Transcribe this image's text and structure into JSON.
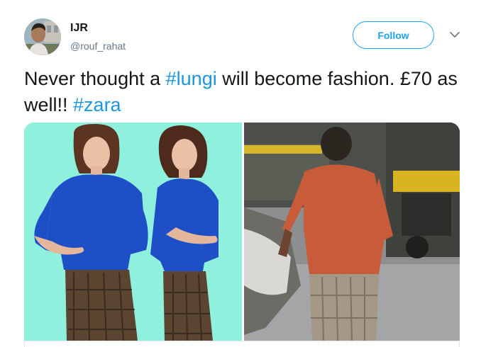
{
  "author": {
    "display_name": "IJR",
    "handle": "@rouf_rahat"
  },
  "actions": {
    "follow_label": "Follow",
    "more_icon": "chevron-down-icon"
  },
  "tweet": {
    "segments": [
      {
        "text": "Never thought a ",
        "type": "text"
      },
      {
        "text": "#lungi",
        "type": "hashtag"
      },
      {
        "text": " will become fashion. £70 as well!! ",
        "type": "text"
      },
      {
        "text": "#zara",
        "type": "hashtag"
      }
    ]
  },
  "media": {
    "photos": [
      "zara-model-photo",
      "street-worker-photo"
    ]
  },
  "colors": {
    "accent": "#1da1f2",
    "hashtag": "#1b95e0",
    "text": "#14171a",
    "secondary_text": "#657786",
    "left_photo_bg": "#8ff0de"
  }
}
